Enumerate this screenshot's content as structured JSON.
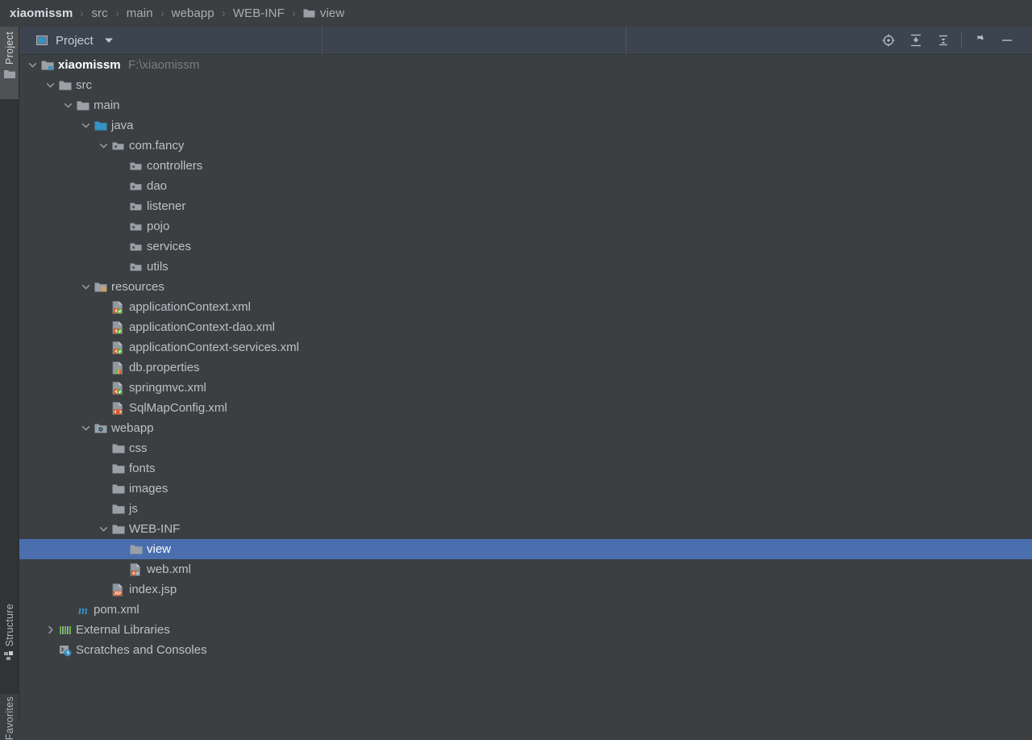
{
  "breadcrumb": {
    "separator": "›",
    "items": [
      {
        "label": "xiaomissm",
        "icon": "none"
      },
      {
        "label": "src",
        "icon": "none"
      },
      {
        "label": "main",
        "icon": "none"
      },
      {
        "label": "webapp",
        "icon": "none"
      },
      {
        "label": "WEB-INF",
        "icon": "none"
      },
      {
        "label": "view",
        "icon": "folder-icon"
      }
    ]
  },
  "left_strip": {
    "tabs": [
      {
        "label": "Project",
        "icon": "folder-icon",
        "active": true
      },
      {
        "label": "Structure",
        "icon": "structure-icon",
        "active": false
      },
      {
        "label": "Favorites",
        "icon": "none",
        "active": false
      }
    ]
  },
  "toolwindow": {
    "title": "Project",
    "caret_icon": "chevron-down-icon",
    "title_icon": "project-window-icon",
    "actions": [
      {
        "name": "locate-file-icon",
        "tooltip": "Select Opened File"
      },
      {
        "name": "expand-all-icon",
        "tooltip": "Expand All"
      },
      {
        "name": "collapse-all-icon",
        "tooltip": "Collapse All"
      },
      {
        "name": "settings-gear-icon",
        "tooltip": "Settings"
      },
      {
        "name": "hide-icon",
        "tooltip": "Hide"
      }
    ]
  },
  "colors": {
    "background": "#3c3f41",
    "header_background": "#3c4450",
    "selection": "#4b6eaf",
    "text": "#bcc1c7",
    "text_dim": "#787d83",
    "accent_cyan": "#3592c4",
    "accent_orange": "#cf5d28",
    "accent_green": "#62b543"
  },
  "tree": {
    "rows": [
      {
        "label": "xiaomissm",
        "sublabel": "F:\\xiaomissm",
        "depth": 0,
        "arrow": "expanded",
        "icon": "module-folder-icon",
        "bold": true,
        "selected": false
      },
      {
        "label": "src",
        "sublabel": "",
        "depth": 1,
        "arrow": "expanded",
        "icon": "folder-icon",
        "bold": false,
        "selected": false
      },
      {
        "label": "main",
        "sublabel": "",
        "depth": 2,
        "arrow": "expanded",
        "icon": "folder-icon",
        "bold": false,
        "selected": false
      },
      {
        "label": "java",
        "sublabel": "",
        "depth": 3,
        "arrow": "expanded",
        "icon": "source-root-icon",
        "bold": false,
        "selected": false
      },
      {
        "label": "com.fancy",
        "sublabel": "",
        "depth": 4,
        "arrow": "expanded",
        "icon": "package-icon",
        "bold": false,
        "selected": false
      },
      {
        "label": "controllers",
        "sublabel": "",
        "depth": 5,
        "arrow": "none",
        "icon": "package-icon",
        "bold": false,
        "selected": false
      },
      {
        "label": "dao",
        "sublabel": "",
        "depth": 5,
        "arrow": "none",
        "icon": "package-icon",
        "bold": false,
        "selected": false
      },
      {
        "label": "listener",
        "sublabel": "",
        "depth": 5,
        "arrow": "none",
        "icon": "package-icon",
        "bold": false,
        "selected": false
      },
      {
        "label": "pojo",
        "sublabel": "",
        "depth": 5,
        "arrow": "none",
        "icon": "package-icon",
        "bold": false,
        "selected": false
      },
      {
        "label": "services",
        "sublabel": "",
        "depth": 5,
        "arrow": "none",
        "icon": "package-icon",
        "bold": false,
        "selected": false
      },
      {
        "label": "utils",
        "sublabel": "",
        "depth": 5,
        "arrow": "none",
        "icon": "package-icon",
        "bold": false,
        "selected": false
      },
      {
        "label": "resources",
        "sublabel": "",
        "depth": 3,
        "arrow": "expanded",
        "icon": "resource-root-icon",
        "bold": false,
        "selected": false
      },
      {
        "label": "applicationContext.xml",
        "sublabel": "",
        "depth": 4,
        "arrow": "none",
        "icon": "spring-xml-icon",
        "bold": false,
        "selected": false
      },
      {
        "label": "applicationContext-dao.xml",
        "sublabel": "",
        "depth": 4,
        "arrow": "none",
        "icon": "spring-xml-icon",
        "bold": false,
        "selected": false
      },
      {
        "label": "applicationContext-services.xml",
        "sublabel": "",
        "depth": 4,
        "arrow": "none",
        "icon": "spring-xml-icon",
        "bold": false,
        "selected": false
      },
      {
        "label": "db.properties",
        "sublabel": "",
        "depth": 4,
        "arrow": "none",
        "icon": "properties-file-icon",
        "bold": false,
        "selected": false
      },
      {
        "label": "springmvc.xml",
        "sublabel": "",
        "depth": 4,
        "arrow": "none",
        "icon": "spring-xml-icon",
        "bold": false,
        "selected": false
      },
      {
        "label": "SqlMapConfig.xml",
        "sublabel": "",
        "depth": 4,
        "arrow": "none",
        "icon": "xml-file-icon",
        "bold": false,
        "selected": false
      },
      {
        "label": "webapp",
        "sublabel": "",
        "depth": 3,
        "arrow": "expanded",
        "icon": "web-root-icon",
        "bold": false,
        "selected": false
      },
      {
        "label": "css",
        "sublabel": "",
        "depth": 4,
        "arrow": "none",
        "icon": "folder-icon",
        "bold": false,
        "selected": false
      },
      {
        "label": "fonts",
        "sublabel": "",
        "depth": 4,
        "arrow": "none",
        "icon": "folder-icon",
        "bold": false,
        "selected": false
      },
      {
        "label": "images",
        "sublabel": "",
        "depth": 4,
        "arrow": "none",
        "icon": "folder-icon",
        "bold": false,
        "selected": false
      },
      {
        "label": "js",
        "sublabel": "",
        "depth": 4,
        "arrow": "none",
        "icon": "folder-icon",
        "bold": false,
        "selected": false
      },
      {
        "label": "WEB-INF",
        "sublabel": "",
        "depth": 4,
        "arrow": "expanded",
        "icon": "folder-icon",
        "bold": false,
        "selected": false
      },
      {
        "label": "view",
        "sublabel": "",
        "depth": 5,
        "arrow": "none",
        "icon": "folder-icon",
        "bold": false,
        "selected": true
      },
      {
        "label": "web.xml",
        "sublabel": "",
        "depth": 5,
        "arrow": "none",
        "icon": "web-xml-icon",
        "bold": false,
        "selected": false
      },
      {
        "label": "index.jsp",
        "sublabel": "",
        "depth": 4,
        "arrow": "none",
        "icon": "jsp-file-icon",
        "bold": false,
        "selected": false
      },
      {
        "label": "pom.xml",
        "sublabel": "",
        "depth": 2,
        "arrow": "none",
        "icon": "maven-icon",
        "bold": false,
        "selected": false
      },
      {
        "label": "External Libraries",
        "sublabel": "",
        "depth": 1,
        "arrow": "collapsed",
        "icon": "libraries-icon",
        "bold": false,
        "selected": false
      },
      {
        "label": "Scratches and Consoles",
        "sublabel": "",
        "depth": 1,
        "arrow": "none",
        "icon": "scratches-icon",
        "bold": false,
        "selected": false
      }
    ]
  }
}
